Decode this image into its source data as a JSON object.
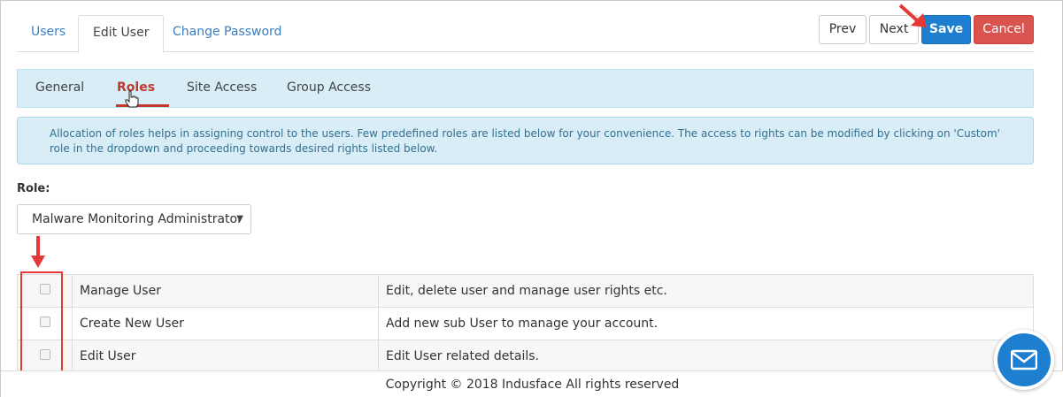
{
  "top_tabs": [
    {
      "label": "Users",
      "active": false
    },
    {
      "label": "Edit User",
      "active": true
    },
    {
      "label": "Change Password",
      "active": false
    }
  ],
  "actions": {
    "prev": "Prev",
    "next": "Next",
    "save": "Save",
    "cancel": "Cancel"
  },
  "sub_tabs": [
    {
      "label": "General",
      "active": false
    },
    {
      "label": "Roles",
      "active": true
    },
    {
      "label": "Site Access",
      "active": false
    },
    {
      "label": "Group Access",
      "active": false
    }
  ],
  "info": {
    "text": "Allocation of roles helps in assigning control to the users. Few predefined roles are listed below for your convenience. The access to rights can be modified by clicking on 'Custom' role in the dropdown and proceeding towards desired rights listed below."
  },
  "role": {
    "label": "Role:",
    "selected": "Malware Monitoring Administrator"
  },
  "rights": [
    {
      "name": "Manage User",
      "description": "Edit, delete user and manage user rights etc.",
      "checked": false
    },
    {
      "name": "Create New User",
      "description": "Add new sub User to manage your account.",
      "checked": false
    },
    {
      "name": "Edit User",
      "description": "Edit User related details.",
      "checked": false
    }
  ],
  "footer": {
    "copyright": "Copyright © 2018 Indusface All rights reserved"
  },
  "colors": {
    "accent": "#1e7fd0",
    "danger": "#d9534f",
    "annotation": "#e53935",
    "active_subtab": "#c0392b",
    "info_bg": "#d9edf7"
  },
  "icons": [
    "chevron-down-icon",
    "hand-cursor-icon",
    "envelope-icon",
    "annotation-arrow"
  ]
}
